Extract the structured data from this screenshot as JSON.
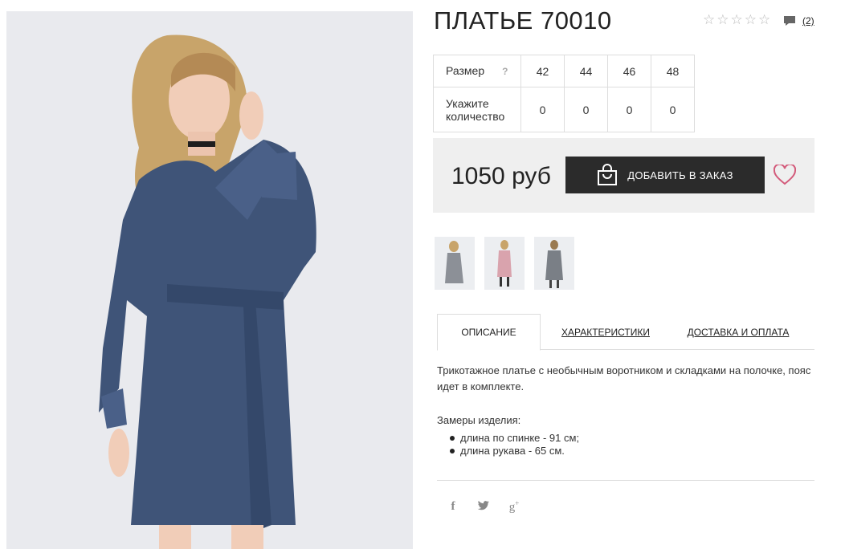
{
  "product": {
    "title": "ПЛАТЬЕ 70010",
    "rating": 0,
    "rating_max": 5,
    "reviews_count": "(2)",
    "price": "1050 руб",
    "add_to_cart_label": "ДОБАВИТЬ В ЗАКАЗ"
  },
  "size_table": {
    "size_label": "Размер",
    "help_label": "?",
    "quantity_label": "Укажите количество",
    "sizes": [
      "42",
      "44",
      "46",
      "48"
    ],
    "quantities": [
      "0",
      "0",
      "0",
      "0"
    ]
  },
  "thumbnails": [
    {
      "name": "thumb-gray-dress",
      "color": "#8c9097"
    },
    {
      "name": "thumb-pink-dress",
      "color": "#d9a3ad"
    },
    {
      "name": "thumb-grey-dress-2",
      "color": "#7a7f86"
    }
  ],
  "tabs": [
    {
      "label": "ОПИСАНИЕ",
      "active": true
    },
    {
      "label": "ХАРАКТЕРИСТИКИ",
      "active": false
    },
    {
      "label": "ДОСТАВКА И ОПЛАТА",
      "active": false
    }
  ],
  "description": {
    "text": "Трикотажное платье с необычным воротником и складками на полочке, пояс идет в комплекте.",
    "measures_title": "Замеры изделия:",
    "measures": [
      "длина по спинке - 91 см;",
      "длина рукава - 65 см."
    ]
  },
  "social": [
    {
      "name": "facebook-icon",
      "glyph": "f"
    },
    {
      "name": "twitter-icon",
      "glyph": "🐦"
    },
    {
      "name": "google-plus-icon",
      "glyph": "g+"
    }
  ],
  "colors": {
    "button_bg": "#2b2b2b",
    "price_box_bg": "#efefef",
    "heart": "#d35a7a",
    "dress": "#3f5478"
  }
}
